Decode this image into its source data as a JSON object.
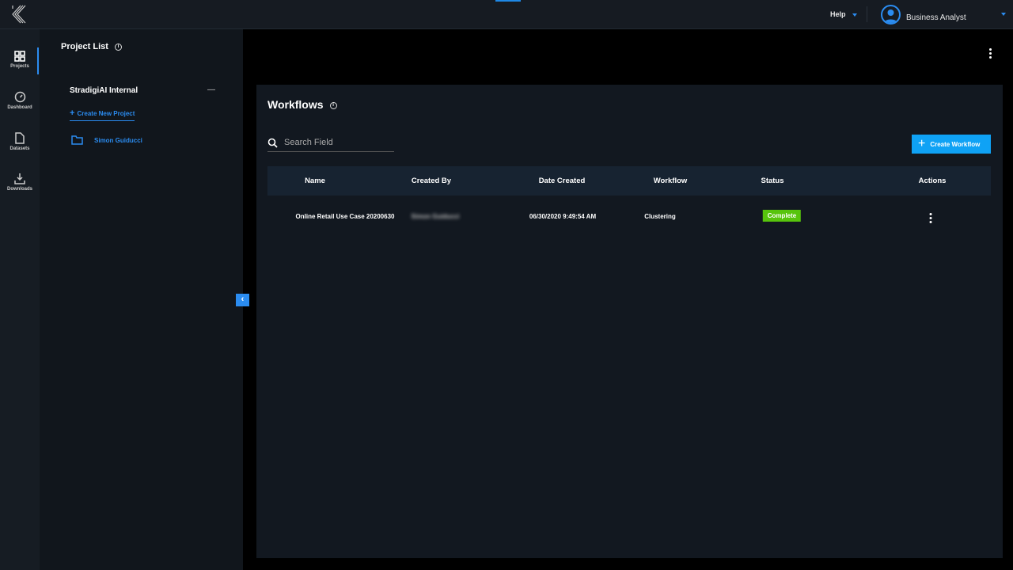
{
  "topbar": {
    "help": "Help",
    "user": "Business Analyst"
  },
  "nav": [
    {
      "label": "Projects",
      "icon": "grid-icon"
    },
    {
      "label": "Dashboard",
      "icon": "gauge-icon"
    },
    {
      "label": "Datasets",
      "icon": "file-icon"
    },
    {
      "label": "Downloads",
      "icon": "download-icon"
    }
  ],
  "project_list": {
    "title": "Project List",
    "org": "StradigiAI Internal",
    "create": "Create New Project",
    "projects": [
      "Simon Guiducci"
    ]
  },
  "workflows": {
    "title": "Workflows",
    "search_placeholder": "Search Field",
    "create_button": "Create Workflow",
    "columns": [
      "Name",
      "Created By",
      "Date Created",
      "Workflow",
      "Status",
      "Actions"
    ],
    "rows": [
      {
        "name": "Online Retail Use Case 20200630",
        "created_by": "Simon Guiducci",
        "date": "06/30/2020 9:49:54 AM",
        "workflow": "Clustering",
        "status": "Complete"
      }
    ]
  },
  "colors": {
    "accent": "#2b8cf0",
    "button": "#0fa2f5",
    "complete": "#57c40c"
  }
}
